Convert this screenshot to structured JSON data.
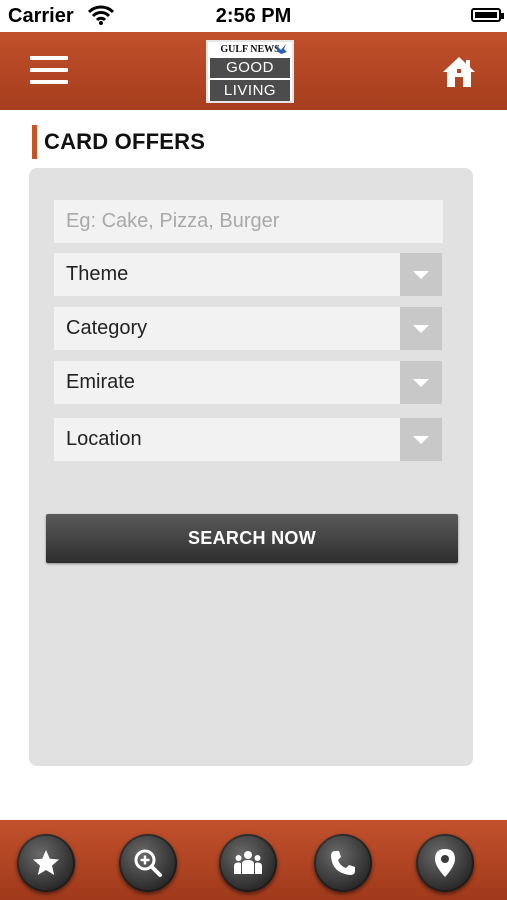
{
  "status_bar": {
    "carrier": "Carrier",
    "time": "2:56 PM"
  },
  "header": {
    "logo": {
      "publisher": "GULF NEWS",
      "line1": "GOOD",
      "line2": "LIVING"
    }
  },
  "page": {
    "title": "CARD OFFERS"
  },
  "form": {
    "search_placeholder": "Eg: Cake, Pizza, Burger",
    "search_value": "",
    "selects": [
      {
        "label": "Theme"
      },
      {
        "label": "Category"
      },
      {
        "label": "Emirate"
      },
      {
        "label": "Location"
      }
    ],
    "submit_label": "SEARCH NOW"
  },
  "tabbar": {
    "items": [
      {
        "icon": "star-icon"
      },
      {
        "icon": "zoom-in-icon"
      },
      {
        "icon": "people-icon"
      },
      {
        "icon": "phone-icon"
      },
      {
        "icon": "location-pin-icon"
      }
    ]
  },
  "colors": {
    "brand": "#b5461f",
    "accent_bar": "#c65427",
    "panel": "#e1e1e1",
    "button_dark": "#3a3a3a"
  }
}
